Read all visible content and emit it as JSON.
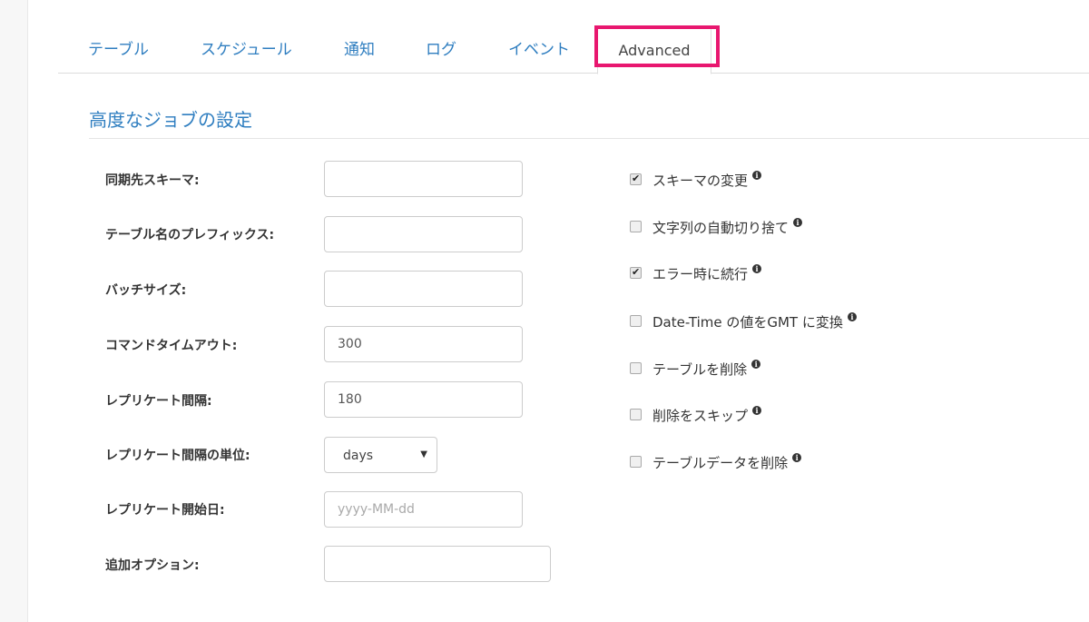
{
  "tabs": [
    {
      "label": "テーブル"
    },
    {
      "label": "スケジュール"
    },
    {
      "label": "通知"
    },
    {
      "label": "ログ"
    },
    {
      "label": "イベント"
    },
    {
      "label": "Advanced",
      "active": true
    }
  ],
  "section": {
    "title": "高度なジョブの設定"
  },
  "form": {
    "fields": [
      {
        "label": "同期先スキーマ:",
        "value": "",
        "placeholder": ""
      },
      {
        "label": "テーブル名のプレフィックス:",
        "value": "",
        "placeholder": ""
      },
      {
        "label": "バッチサイズ:",
        "value": "",
        "placeholder": ""
      },
      {
        "label": "コマンドタイムアウト:",
        "value": "300",
        "placeholder": ""
      },
      {
        "label": "レプリケート間隔:",
        "value": "180",
        "placeholder": ""
      },
      {
        "label": "レプリケート間隔の単位:",
        "value": "days",
        "placeholder": ""
      },
      {
        "label": "レプリケート開始日:",
        "value": "",
        "placeholder": "yyyy-MM-dd"
      },
      {
        "label": "追加オプション:",
        "value": "",
        "placeholder": ""
      }
    ]
  },
  "options": [
    {
      "label": "スキーマの変更",
      "checked": true,
      "icon": "info-icon"
    },
    {
      "label": "文字列の自動切り捨て",
      "checked": false,
      "icon": "info-icon"
    },
    {
      "label": "エラー時に続行",
      "checked": true,
      "icon": "info-icon"
    },
    {
      "label": "Date-Time の値をGMT に変換",
      "checked": false,
      "icon": "info-icon"
    },
    {
      "label": "テーブルを削除",
      "checked": false,
      "icon": "info-icon"
    },
    {
      "label": "削除をスキップ",
      "checked": false,
      "icon": "info-icon"
    },
    {
      "label": "テーブルデータを削除",
      "checked": false,
      "icon": "info-icon"
    }
  ],
  "colors": {
    "link": "#2f7ec0",
    "highlight": "#e8176f",
    "border": "#cccccc"
  }
}
